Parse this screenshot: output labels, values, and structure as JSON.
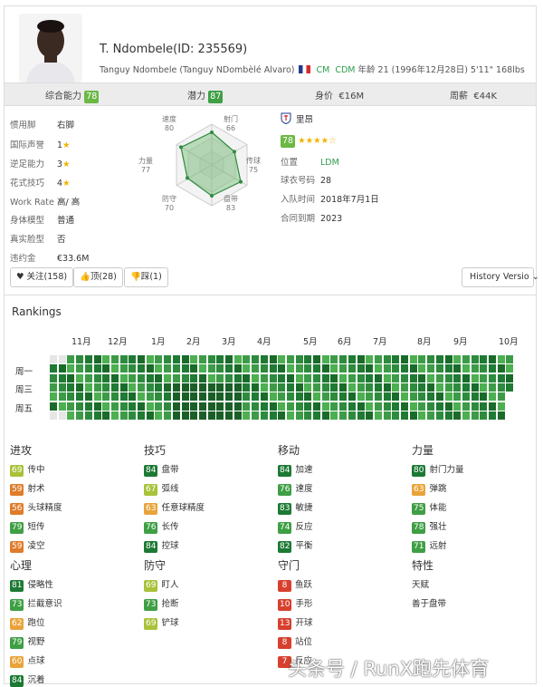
{
  "player": {
    "name": "T. Ndombele(ID: 235569)",
    "full_name": "Tanguy Ndombele (Tanguy NDombèlé Alvaro)",
    "pos1": "CM",
    "pos2": "CDM",
    "details": "年龄 21 (1996年12月28日) 5'11\" 168lbs"
  },
  "summary": [
    {
      "label": "综合能力",
      "value": "78",
      "color": "#6bb845"
    },
    {
      "label": "潜力",
      "value": "87",
      "color": "#3f9f45"
    },
    {
      "label": "身价",
      "value": "€16M"
    },
    {
      "label": "周薪",
      "value": "€44K"
    }
  ],
  "info": [
    {
      "k": "惯用脚",
      "v": "右脚"
    },
    {
      "k": "国际声誉",
      "v": "1",
      "stars": 1
    },
    {
      "k": "逆足能力",
      "v": "3",
      "stars": 1
    },
    {
      "k": "花式技巧",
      "v": "4",
      "stars": 1
    },
    {
      "k": "Work Rate",
      "v": "高/ 高"
    },
    {
      "k": "身体模型",
      "v": "普通"
    },
    {
      "k": "真实脸型",
      "v": "否"
    },
    {
      "k": "违约金",
      "v": "€33.6M"
    }
  ],
  "radar": [
    {
      "label": "速度",
      "value": "80"
    },
    {
      "label": "射门",
      "value": "66"
    },
    {
      "label": "传球",
      "value": "75"
    },
    {
      "label": "盘带",
      "value": "83"
    },
    {
      "label": "防守",
      "value": "70"
    },
    {
      "label": "力量",
      "value": "77"
    }
  ],
  "club": {
    "name": "里昂",
    "rating": "78",
    "stars": "★★★★☆",
    "position_k": "位置",
    "position": "LDM",
    "number_k": "球衣号码",
    "number": "28",
    "joined_k": "入队时间",
    "joined": "2018年7月1日",
    "contract_k": "合同到期",
    "contract": "2023"
  },
  "buttons": {
    "like": "♥ 关注(158)",
    "up": "顶(28)",
    "down": "踩(1)",
    "history": "History Versio"
  },
  "rankings": {
    "title": "Rankings",
    "months": [
      "11月",
      "12月",
      "1月",
      "2月",
      "3月",
      "4月",
      "5月",
      "6月",
      "7月",
      "8月",
      "9月",
      "10月"
    ],
    "days": [
      "周一",
      "周三",
      "周五"
    ]
  },
  "categories": [
    {
      "title": "进攻",
      "items": [
        [
          "69",
          "传中"
        ],
        [
          "59",
          "射术"
        ],
        [
          "56",
          "头球精度"
        ],
        [
          "79",
          "短传"
        ],
        [
          "59",
          "凌空"
        ]
      ]
    },
    {
      "title": "技巧",
      "items": [
        [
          "84",
          "盘带"
        ],
        [
          "67",
          "弧线"
        ],
        [
          "63",
          "任意球精度"
        ],
        [
          "76",
          "长传"
        ],
        [
          "84",
          "控球"
        ]
      ]
    },
    {
      "title": "移动",
      "items": [
        [
          "84",
          "加速"
        ],
        [
          "76",
          "速度"
        ],
        [
          "83",
          "敏捷"
        ],
        [
          "74",
          "反应"
        ],
        [
          "82",
          "平衡"
        ]
      ]
    },
    {
      "title": "力量",
      "items": [
        [
          "80",
          "射门力量"
        ],
        [
          "63",
          "弹跳"
        ],
        [
          "75",
          "体能"
        ],
        [
          "78",
          "强壮"
        ],
        [
          "71",
          "远射"
        ]
      ]
    },
    {
      "title": "心理",
      "items": [
        [
          "81",
          "侵略性"
        ],
        [
          "73",
          "拦截意识"
        ],
        [
          "62",
          "跑位"
        ],
        [
          "79",
          "视野"
        ],
        [
          "60",
          "点球"
        ],
        [
          "84",
          "沉着"
        ]
      ]
    },
    {
      "title": "防守",
      "items": [
        [
          "69",
          "盯人"
        ],
        [
          "73",
          "抢断"
        ],
        [
          "69",
          "铲球"
        ]
      ]
    },
    {
      "title": "守门",
      "items": [
        [
          "8",
          "鱼跃"
        ],
        [
          "10",
          "手形"
        ],
        [
          "13",
          "开球"
        ],
        [
          "8",
          "站位"
        ],
        [
          "7",
          "反应"
        ]
      ]
    },
    {
      "title": "特性",
      "items": [
        [
          "",
          "天赋"
        ],
        [
          "",
          "善于盘带"
        ]
      ]
    }
  ],
  "watermark": "头条号 / RunX跑先体育"
}
